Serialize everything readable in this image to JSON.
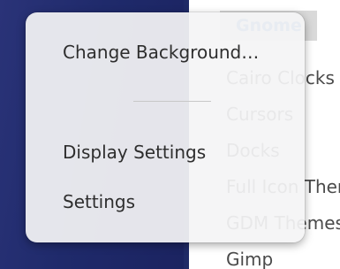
{
  "context_menu": {
    "items": [
      {
        "label": "Change Background…"
      },
      {
        "label": "Display Settings"
      },
      {
        "label": "Settings"
      }
    ]
  },
  "background_page": {
    "header": "Gnome",
    "categories": [
      "Cairo Clocks",
      "Cursors",
      "Docks",
      "Full Icon Themes",
      "GDM Themes",
      "Gimp"
    ]
  },
  "colors": {
    "desktop": "#232d6e",
    "menu_bg": "#f4f4f5",
    "header_text": "#4a80c2",
    "header_bg": "#d9d9d9"
  }
}
